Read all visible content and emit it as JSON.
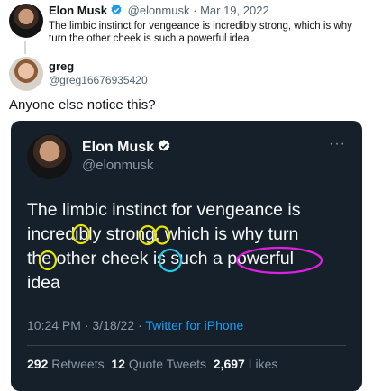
{
  "quoted_tweet": {
    "name": "Elon Musk",
    "handle": "@elonmusk",
    "separator": "·",
    "date": "Mar 19, 2022",
    "text_line1": "The limbic instinct for vengeance is incredibly strong, which is why",
    "text_line2": "turn the other cheek is such a powerful idea"
  },
  "reply": {
    "name": "greg",
    "handle": "@greg16676935420",
    "text": "Anyone else notice this?"
  },
  "embed": {
    "name": "Elon Musk",
    "handle": "@elonmusk",
    "more": "···",
    "lines": [
      "The limbic instinct for vengeance is",
      "incredibly strong, which is why turn",
      "the other cheek is such a powerful",
      "idea"
    ],
    "time": "10:24 PM",
    "date": "3/18/22",
    "dot": "·",
    "source": "Twitter for iPhone",
    "retweets_count": "292",
    "retweets_label": "Retweets",
    "quotes_count": "12",
    "quotes_label": "Quote Tweets",
    "likes_count": "2,697",
    "likes_label": "Likes"
  },
  "colors": {
    "verified": "#1d9bf0",
    "card_bg": "#15202b",
    "circle_yellow": "#e8e600",
    "circle_cyan": "#28c8e8",
    "circle_magenta": "#e020e0"
  }
}
